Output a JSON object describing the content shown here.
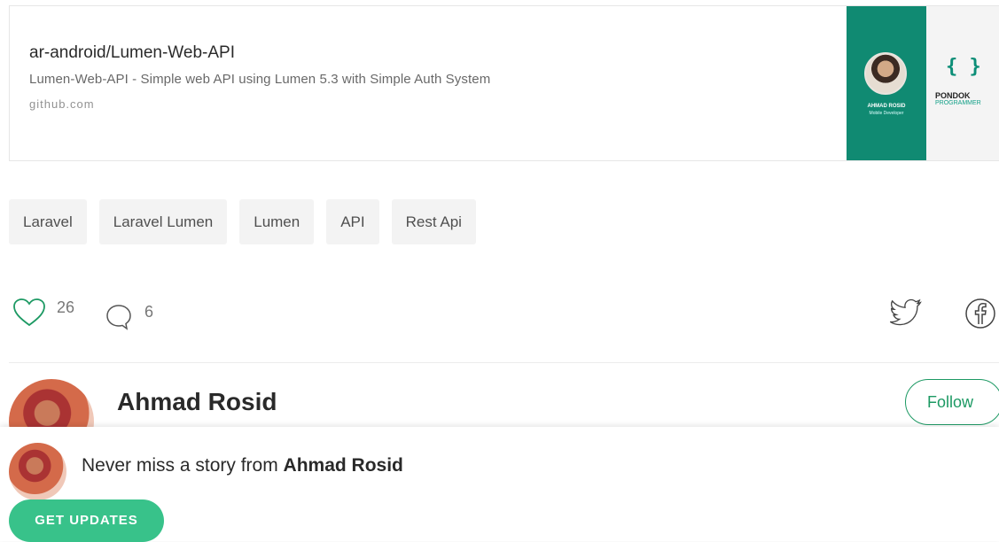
{
  "link_card": {
    "title": "ar-android/Lumen-Web-API",
    "description": "Lumen-Web-API - Simple web API using Lumen 5.3 with Simple Auth System",
    "domain": "github.com",
    "thumb_name": "AHMAD ROSID",
    "thumb_role": "Mobile Developer",
    "thumb_logo_braces": "{ }",
    "thumb_logo_pondok": "PONDOK",
    "thumb_logo_programmer": "PROGRAMMER"
  },
  "tags": [
    "Laravel",
    "Laravel Lumen",
    "Lumen",
    "API",
    "Rest Api"
  ],
  "actions": {
    "claps": "26",
    "responses": "6"
  },
  "author": {
    "name": "Ahmad Rosid",
    "follow_label": "Follow"
  },
  "bottom_bar": {
    "prefix": "Never miss a story from ",
    "author": "Ahmad Rosid",
    "button_label": "GET UPDATES"
  },
  "colors": {
    "accent_green": "#1c9963",
    "button_green": "#38c28a",
    "thumb_teal": "#108a72"
  }
}
